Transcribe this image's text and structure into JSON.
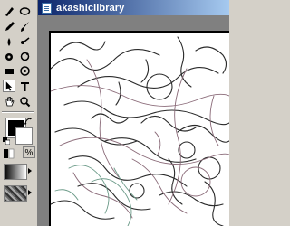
{
  "window": {
    "title": "akashiclibrary"
  },
  "toolbox": {
    "percent_label": "%",
    "foreground_color": "#000000",
    "background_color": "#ffffff",
    "selected_tool": "direct-selection-tool",
    "tools": [
      "pen-tool",
      "ellipse-tool",
      "pencil-tool",
      "brush-tool",
      "eyedropper-tool",
      "blur-tool",
      "smudge-tool",
      "rotate-tool",
      "eraser-tool",
      "gradient-tool",
      "direct-selection-tool",
      "type-tool",
      "hand-tool",
      "zoom-tool"
    ]
  },
  "colors": {
    "titlebar_start": "#0a246a",
    "titlebar_end": "#a6caf0",
    "canvas_bg": "#808080",
    "sketch_dark": "#2a2a2a",
    "sketch_mauve": "#8a6a78",
    "sketch_green": "#6b9a88"
  }
}
